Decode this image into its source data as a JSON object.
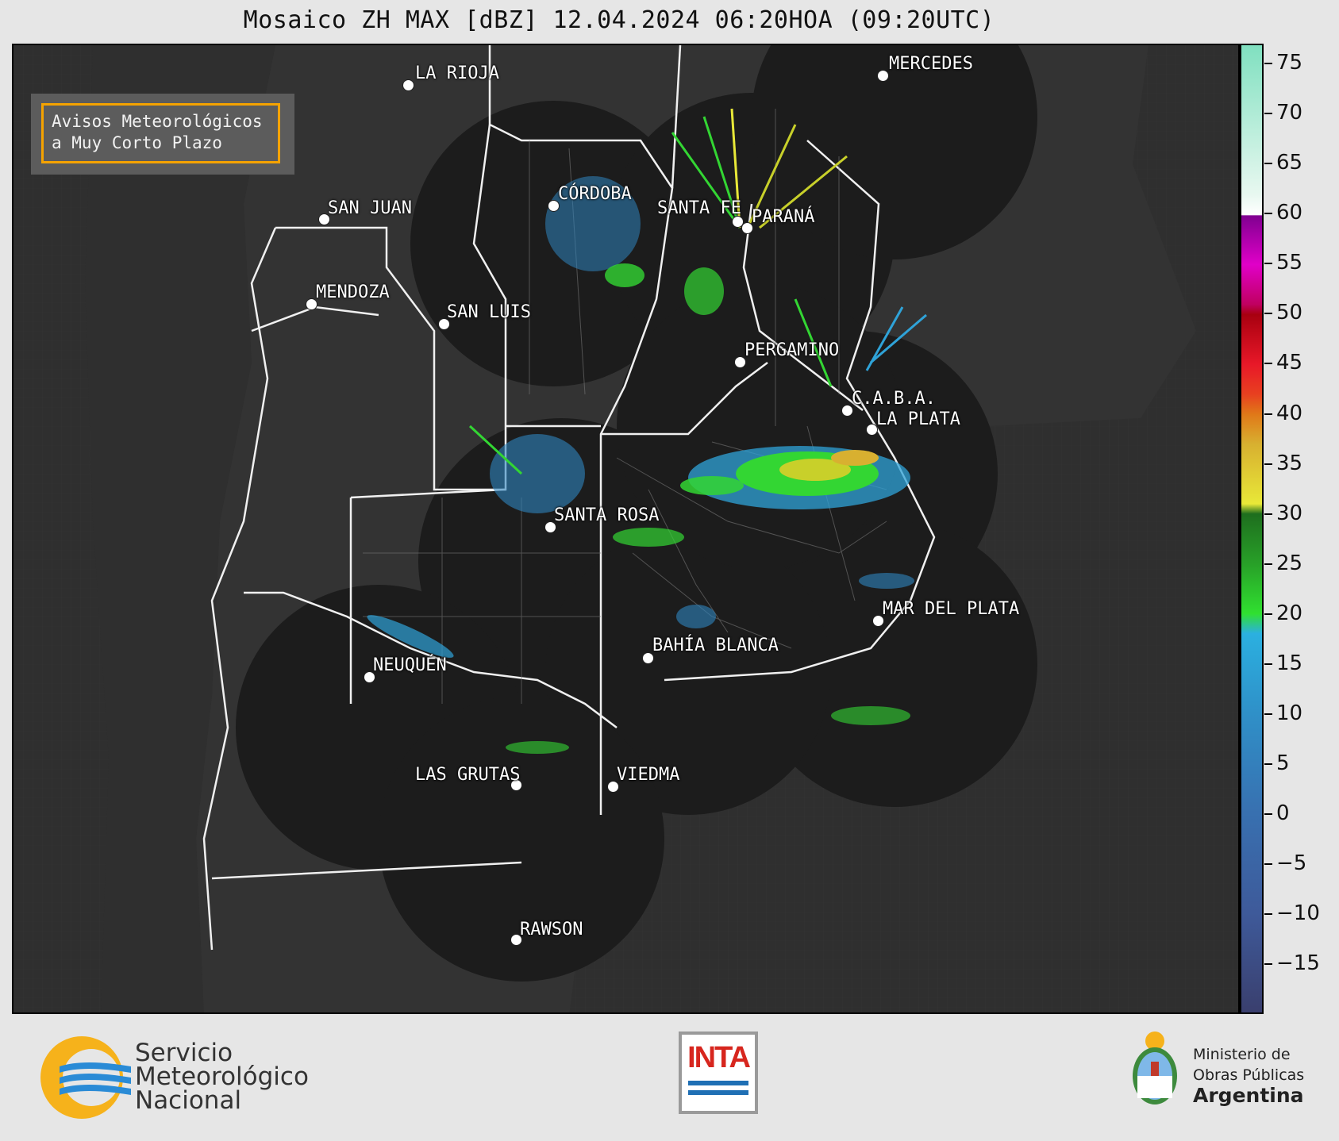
{
  "title": "Mosaico ZH MAX [dBZ] 12.04.2024 06:20HOA (09:20UTC)",
  "notice": {
    "line1": "Avisos Meteorológicos",
    "line2": "a Muy Corto Plazo"
  },
  "cities": [
    {
      "name": "LA RIOJA"
    },
    {
      "name": "MERCEDES"
    },
    {
      "name": "CÓRDOBA"
    },
    {
      "name": "SAN JUAN"
    },
    {
      "name": "SANTA FE"
    },
    {
      "name": "PARANÁ"
    },
    {
      "name": "MENDOZA"
    },
    {
      "name": "SAN LUIS"
    },
    {
      "name": "PERGAMINO"
    },
    {
      "name": "C.A.B.A."
    },
    {
      "name": "LA PLATA"
    },
    {
      "name": "SANTA ROSA"
    },
    {
      "name": "MAR DEL PLATA"
    },
    {
      "name": "BAHÍA BLANCA"
    },
    {
      "name": "NEUQUÉN"
    },
    {
      "name": "LAS GRUTAS"
    },
    {
      "name": "VIEDMA"
    },
    {
      "name": "RAWSON"
    }
  ],
  "colorbar": {
    "unit": "dBZ",
    "range": [
      -20,
      77
    ],
    "ticks": [
      "75",
      "70",
      "65",
      "60",
      "55",
      "50",
      "45",
      "40",
      "35",
      "30",
      "25",
      "20",
      "15",
      "10",
      "5",
      "0",
      "−5",
      "−10",
      "−15"
    ],
    "colors": {
      "minus20": "#3a3f6e",
      "minus10": "#3e5a9a",
      "zero": "#3870b0",
      "ten": "#2f90c8",
      "fifteen": "#2bb0e0",
      "twenty": "#30e030",
      "thirty": "#1e6e1e",
      "yellow30": "#e8e838",
      "orange40": "#e07818",
      "red45": "#e81828",
      "darkred50": "#a80010",
      "magenta55": "#e000c8",
      "purple58": "#800090",
      "white60": "#ffffff",
      "teal75": "#80e0c0"
    }
  },
  "logos": {
    "smn": {
      "line1": "Servicio",
      "line2": "Meteorológico",
      "line3": "Nacional"
    },
    "inta": "INTA",
    "ministerio": {
      "line1": "Ministerio de",
      "line2": "Obras Públicas",
      "line3": "Argentina"
    }
  }
}
